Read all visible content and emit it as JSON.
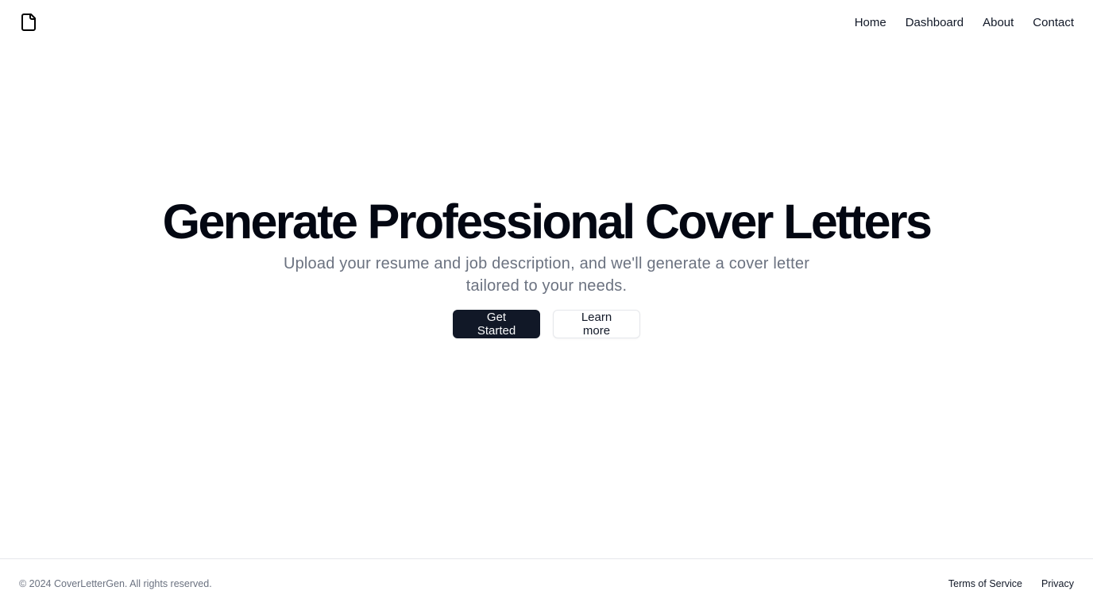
{
  "header": {
    "logo_icon": "file-icon",
    "nav": [
      {
        "label": "Home"
      },
      {
        "label": "Dashboard"
      },
      {
        "label": "About"
      },
      {
        "label": "Contact"
      }
    ]
  },
  "hero": {
    "title": "Generate Professional Cover Letters",
    "subtitle": "Upload your resume and job description, and we'll generate a cover letter tailored to your needs.",
    "primary_button": "Get Started",
    "secondary_button": "Learn more"
  },
  "footer": {
    "copyright": "© 2024 CoverLetterGen. All rights reserved.",
    "links": [
      {
        "label": "Terms of Service"
      },
      {
        "label": "Privacy"
      }
    ]
  },
  "colors": {
    "primary_button_bg": "#111827",
    "text_muted": "#6b7280",
    "border": "#e5e7eb"
  }
}
